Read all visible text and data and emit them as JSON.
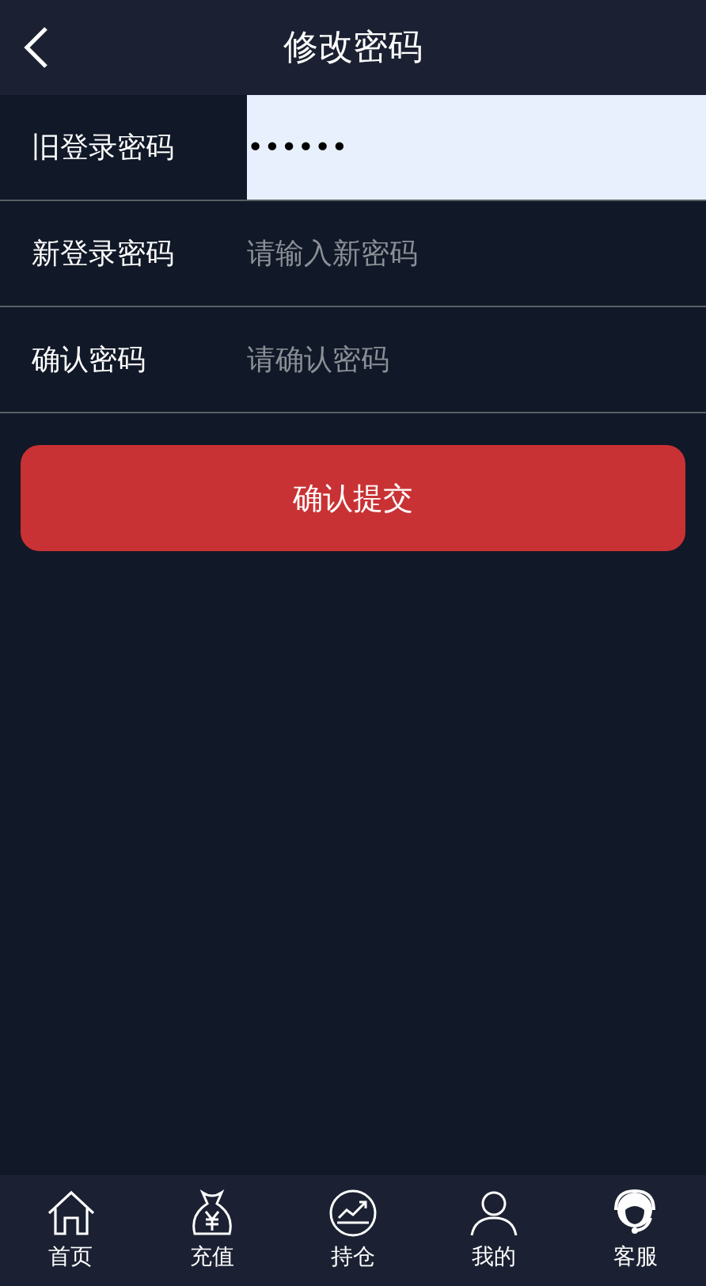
{
  "header": {
    "title": "修改密码"
  },
  "fields": [
    {
      "label": "旧登录密码",
      "value": "••••••",
      "focused": true
    },
    {
      "label": "新登录密码",
      "placeholder": "请输入新密码",
      "focused": false
    },
    {
      "label": "确认密码",
      "placeholder": "请确认密码",
      "focused": false
    }
  ],
  "submit_button": "确认提交",
  "tab_bar": [
    {
      "label": "首页",
      "kind": "home"
    },
    {
      "label": "充值",
      "kind": "bag"
    },
    {
      "label": "持仓",
      "kind": "chart"
    },
    {
      "label": "我的",
      "kind": "user"
    },
    {
      "label": "客服",
      "kind": "support"
    }
  ]
}
